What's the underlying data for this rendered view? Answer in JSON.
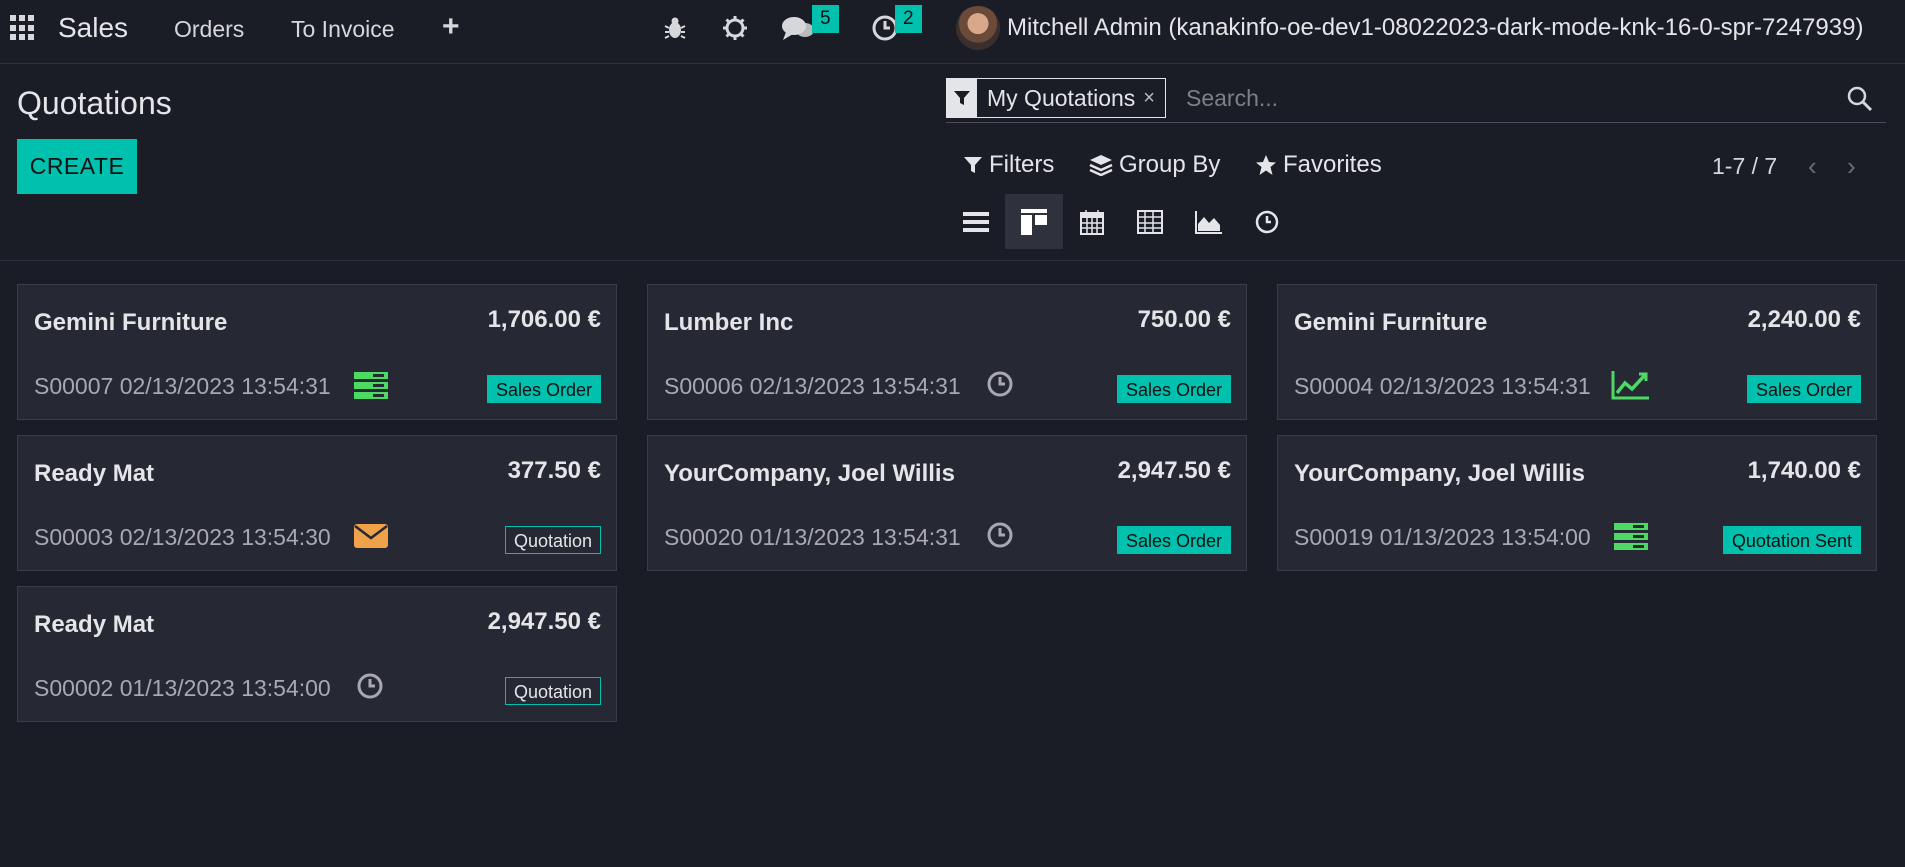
{
  "navbar": {
    "app_name": "Sales",
    "menu": [
      "Orders",
      "To Invoice"
    ],
    "plus": "+",
    "messages_count": "5",
    "activities_count": "2",
    "user": "Mitchell Admin (kanakinfo-oe-dev1-08022023-dark-mode-knk-16-0-spr-7247939)"
  },
  "control": {
    "title": "Quotations",
    "create_label": "CREATE",
    "facet_label": "My Quotations",
    "facet_close": "×",
    "search_placeholder": "Search...",
    "filters_label": "Filters",
    "groupby_label": "Group By",
    "favorites_label": "Favorites",
    "pager": "1-7 / 7",
    "pager_prev": "‹",
    "pager_next": "›"
  },
  "colors": {
    "accent": "#00c1ad",
    "activity_green": "#4cd964",
    "activity_orange": "#f0a24b",
    "activity_grey": "#a8a9b0"
  },
  "cards": [
    {
      "partner": "Gemini Furniture",
      "amount": "1,706.00 €",
      "ref": "S00007 02/13/2023 13:54:31",
      "activity_icon": "todo-list-icon",
      "state": "Sales Order",
      "state_style": "filled"
    },
    {
      "partner": "Lumber Inc",
      "amount": "750.00 €",
      "ref": "S00006 02/13/2023 13:54:31",
      "activity_icon": "clock-icon",
      "state": "Sales Order",
      "state_style": "filled"
    },
    {
      "partner": "Gemini Furniture",
      "amount": "2,240.00 €",
      "ref": "S00004 02/13/2023 13:54:31",
      "activity_icon": "chart-line-icon",
      "state": "Sales Order",
      "state_style": "filled"
    },
    {
      "partner": "Ready Mat",
      "amount": "377.50 €",
      "ref": "S00003 02/13/2023 13:54:30",
      "activity_icon": "envelope-icon",
      "state": "Quotation",
      "state_style": "outline"
    },
    {
      "partner": "YourCompany, Joel Willis",
      "amount": "2,947.50 €",
      "ref": "S00020 01/13/2023 13:54:31",
      "activity_icon": "clock-icon",
      "state": "Sales Order",
      "state_style": "filled"
    },
    {
      "partner": "YourCompany, Joel Willis",
      "amount": "1,740.00 €",
      "ref": "S00019 01/13/2023 13:54:00",
      "activity_icon": "todo-list-icon",
      "state": "Quotation Sent",
      "state_style": "filled"
    },
    {
      "partner": "Ready Mat",
      "amount": "2,947.50 €",
      "ref": "S00002 01/13/2023 13:54:00",
      "activity_icon": "clock-icon",
      "state": "Quotation",
      "state_style": "outline"
    }
  ]
}
